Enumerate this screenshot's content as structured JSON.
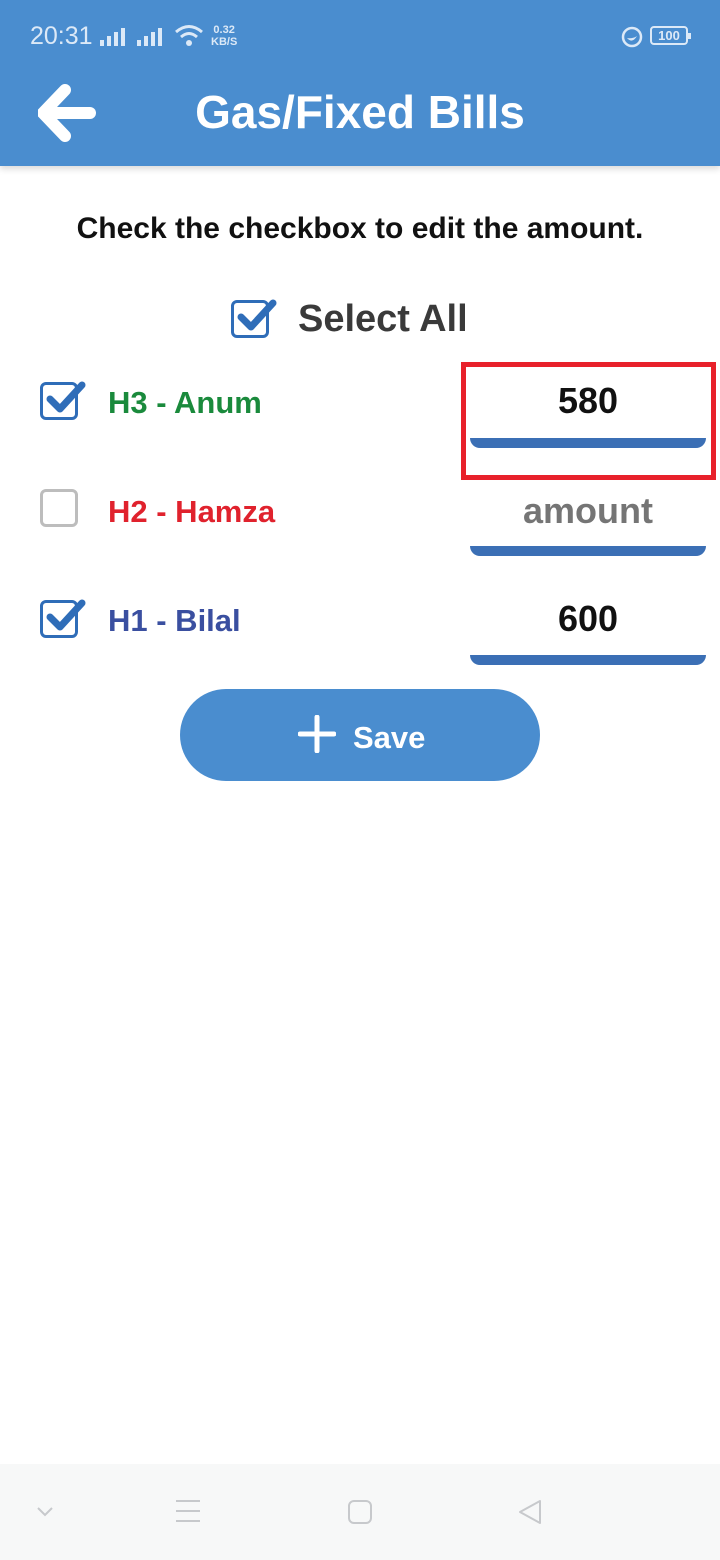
{
  "status_bar": {
    "time": "20:31",
    "net_speed_value": "0.32",
    "net_speed_unit": "KB/S",
    "battery": "100"
  },
  "header": {
    "title": "Gas/Fixed Bills"
  },
  "instruction": "Check the checkbox to edit the amount.",
  "select_all": {
    "label": "Select All",
    "checked": true
  },
  "rows": [
    {
      "label": "H3 - Anum",
      "color": "#1a8a3c",
      "checked": true,
      "value": "580",
      "placeholder": "amount"
    },
    {
      "label": "H2 - Hamza",
      "color": "#e0222d",
      "checked": false,
      "value": "",
      "placeholder": "amount"
    },
    {
      "label": "H1 - Bilal",
      "color": "#3a4fa0",
      "checked": true,
      "value": "600",
      "placeholder": "amount"
    }
  ],
  "save_button": {
    "label": "Save",
    "icon": "plus-icon"
  },
  "colors": {
    "primary": "#4a8dcf",
    "checkbox": "#2f6db8",
    "underline": "#3b6fb5",
    "highlight": "#e8212b"
  }
}
